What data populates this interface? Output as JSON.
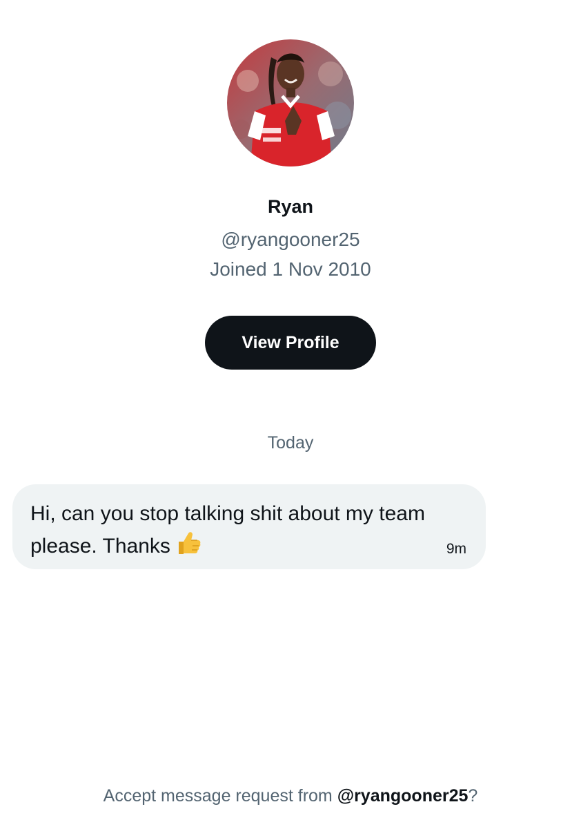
{
  "profile": {
    "display_name": "Ryan",
    "handle": "@ryangooner25",
    "joined": "Joined 1 Nov 2010",
    "view_profile_label": "View Profile"
  },
  "conversation": {
    "date_divider": "Today",
    "messages": [
      {
        "text": "Hi, can you stop talking shit about my team please. Thanks",
        "emoji": "thumbs-up-icon",
        "time": "9m"
      }
    ]
  },
  "request": {
    "prompt": "Accept message request from ",
    "handle": "@ryangooner25",
    "suffix": "?"
  },
  "colors": {
    "button_bg": "#0f1419",
    "muted_text": "#536471",
    "bubble_bg": "#eff3f4",
    "jersey_red": "#d9242b"
  }
}
